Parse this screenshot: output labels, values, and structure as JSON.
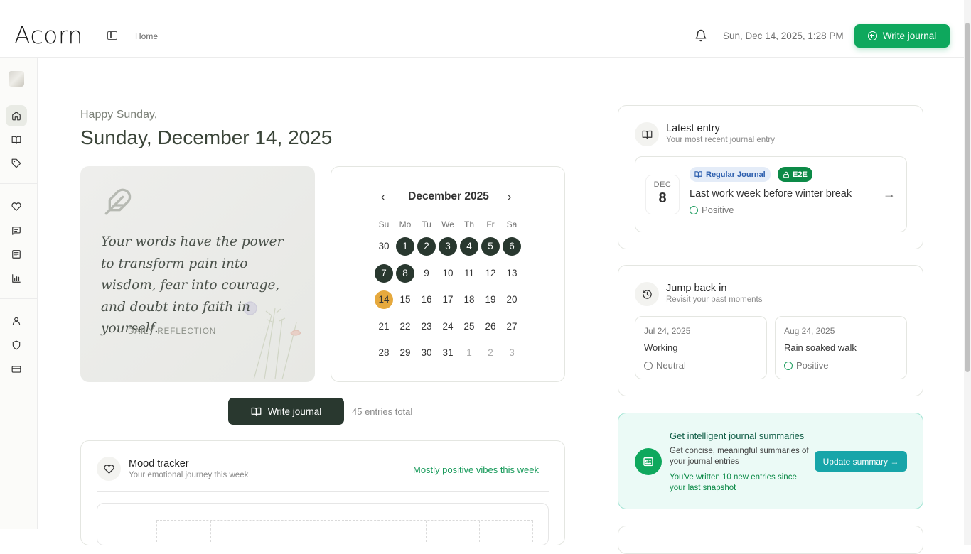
{
  "app": {
    "logo": "Acorn"
  },
  "header": {
    "breadcrumb": "Home",
    "datetime": "Sun, Dec 14, 2025, 1:28 PM",
    "write_button": "Write journal"
  },
  "greeting": {
    "hello": "Happy Sunday,",
    "date": "Sunday, December 14, 2025"
  },
  "quote": {
    "text": "Your words have the power to transform pain into wisdom, fear into courage, and doubt into faith in yourself.",
    "label": "DAILY REFLECTION"
  },
  "calendar": {
    "month": "December 2025",
    "prev": "‹",
    "next": "›",
    "weekdays": [
      "Su",
      "Mo",
      "Tu",
      "We",
      "Th",
      "Fr",
      "Sa"
    ],
    "weeks": [
      [
        {
          "d": "30",
          "s": "normal"
        },
        {
          "d": "1",
          "s": "filled"
        },
        {
          "d": "2",
          "s": "filled"
        },
        {
          "d": "3",
          "s": "filled"
        },
        {
          "d": "4",
          "s": "filled"
        },
        {
          "d": "5",
          "s": "filled"
        },
        {
          "d": "6",
          "s": "filled"
        }
      ],
      [
        {
          "d": "7",
          "s": "filled"
        },
        {
          "d": "8",
          "s": "filled"
        },
        {
          "d": "9",
          "s": "normal"
        },
        {
          "d": "10",
          "s": "normal"
        },
        {
          "d": "11",
          "s": "normal"
        },
        {
          "d": "12",
          "s": "normal"
        },
        {
          "d": "13",
          "s": "normal"
        }
      ],
      [
        {
          "d": "14",
          "s": "today"
        },
        {
          "d": "15",
          "s": "normal"
        },
        {
          "d": "16",
          "s": "normal"
        },
        {
          "d": "17",
          "s": "normal"
        },
        {
          "d": "18",
          "s": "normal"
        },
        {
          "d": "19",
          "s": "normal"
        },
        {
          "d": "20",
          "s": "normal"
        }
      ],
      [
        {
          "d": "21",
          "s": "normal"
        },
        {
          "d": "22",
          "s": "normal"
        },
        {
          "d": "23",
          "s": "normal"
        },
        {
          "d": "24",
          "s": "normal"
        },
        {
          "d": "25",
          "s": "normal"
        },
        {
          "d": "26",
          "s": "normal"
        },
        {
          "d": "27",
          "s": "normal"
        }
      ],
      [
        {
          "d": "28",
          "s": "normal"
        },
        {
          "d": "29",
          "s": "normal"
        },
        {
          "d": "30",
          "s": "normal"
        },
        {
          "d": "31",
          "s": "normal"
        },
        {
          "d": "1",
          "s": "muted"
        },
        {
          "d": "2",
          "s": "muted"
        },
        {
          "d": "3",
          "s": "muted"
        }
      ]
    ]
  },
  "write_row": {
    "button": "Write journal",
    "entries_total": "45 entries total"
  },
  "mood_tracker": {
    "title": "Mood tracker",
    "subtitle": "Your emotional journey this week",
    "summary": "Mostly positive vibes this week"
  },
  "latest_entry": {
    "title": "Latest entry",
    "subtitle": "Your most recent journal entry",
    "month": "DEC",
    "day": "8",
    "tag_type": "Regular Journal",
    "tag_security": "E2E",
    "entry_title": "Last work week before winter break",
    "mood": "Positive"
  },
  "jump_back": {
    "title": "Jump back in",
    "subtitle": "Revisit your past moments",
    "items": [
      {
        "date": "Jul 24, 2025",
        "title": "Working",
        "mood": "Neutral"
      },
      {
        "date": "Aug 24, 2025",
        "title": "Rain soaked walk",
        "mood": "Positive"
      }
    ]
  },
  "summaries": {
    "title": "Get intelligent journal summaries",
    "description": "Get concise, meaningful summaries of your journal entries",
    "note": "You've written 10 new entries since your last snapshot",
    "button": "Update summary →"
  },
  "colors": {
    "accent_green": "#0ea85d",
    "dark_green": "#29382f",
    "today": "#e6a93d",
    "teal": "#17a5a9"
  }
}
